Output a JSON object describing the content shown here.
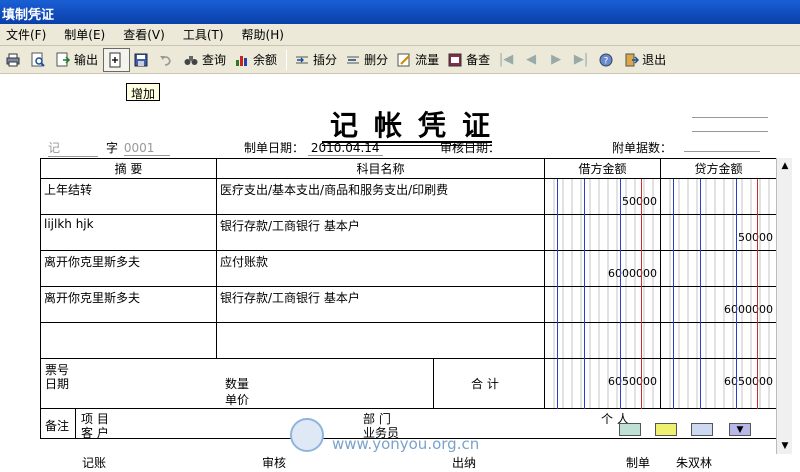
{
  "window": {
    "title": "填制凭证"
  },
  "menu": [
    "文件(F)",
    "制单(E)",
    "查看(V)",
    "工具(T)",
    "帮助(H)"
  ],
  "toolbar": {
    "output": "输出",
    "query": "查询",
    "balance": "余额",
    "insert": "插分",
    "delete": "删分",
    "flow": "流量",
    "remark": "备查",
    "exit": "退出"
  },
  "tooltip": "增加",
  "voucher": {
    "title": "记帐凭证",
    "type": "记",
    "word_label": "字",
    "number": "0001",
    "make_date_label": "制单日期：",
    "make_date": "2010.04.14",
    "audit_date_label": "审核日期：",
    "attachments_label": "附单据数：",
    "headers": {
      "summary": "摘 要",
      "account": "科目名称",
      "debit": "借方金额",
      "credit": "贷方金额"
    },
    "rows": [
      {
        "summary": "上年结转",
        "account": "医疗支出/基本支出/商品和服务支出/印刷费",
        "debit": "50000",
        "credit": ""
      },
      {
        "summary": "lijlkh hjk",
        "account": "银行存款/工商银行 基本户",
        "debit": "",
        "credit": "50000"
      },
      {
        "summary": "离开你克里斯多夫",
        "account": "应付账款",
        "debit": "6000000",
        "credit": ""
      },
      {
        "summary": "离开你克里斯多夫",
        "account": "银行存款/工商银行 基本户",
        "debit": "",
        "credit": "6000000"
      },
      {
        "summary": "",
        "account": "",
        "debit": "",
        "credit": ""
      }
    ],
    "ticket_no_label": "票号",
    "date_label": "日期",
    "quantity_label": "数量",
    "unit_price_label": "单价",
    "total_label": "合 计",
    "total_debit": "6050000",
    "total_credit": "6050000",
    "remark_label": "备注",
    "project_label": "项 目",
    "dept_label": "部 门",
    "person_label": "个 人",
    "customer_label": "客 户",
    "salesman_label": "业务员",
    "bookkeeper_label": "记账",
    "auditor_label": "审核",
    "cashier_label": "出纳",
    "maker_label": "制单",
    "maker": "朱双林"
  },
  "watermark": "www.yonyou.org.cn"
}
